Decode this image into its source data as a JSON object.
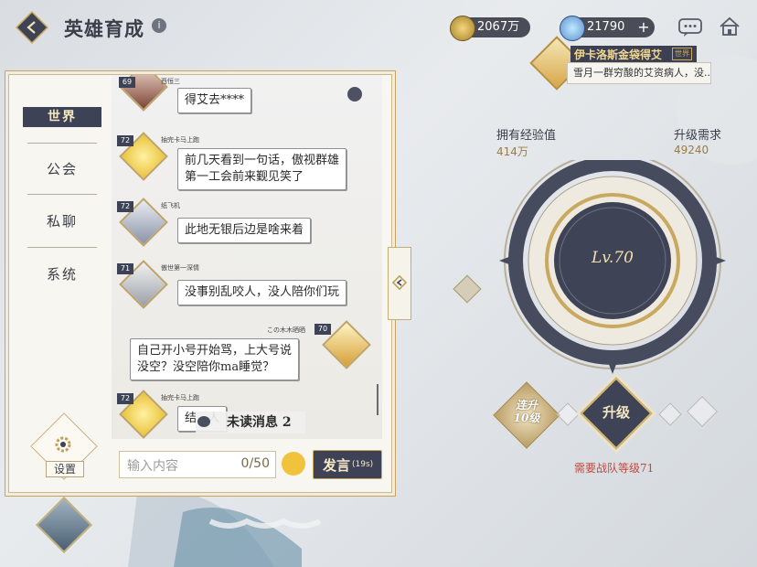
{
  "topbar": {
    "title": "英雄育成",
    "gold": "2067万",
    "gems": "21790",
    "plus": "+",
    "info": "i"
  },
  "hero": {
    "name": "伊卡洛斯金袋得艾",
    "tag": "世界",
    "desc": "雪月一群穷酸的艾资病人，没..."
  },
  "stats": {
    "exp_label": "拥有经验值",
    "exp_value": "414万",
    "need_label": "升级需求",
    "need_value": "49240",
    "level": "Lv.70"
  },
  "actions": {
    "burst_label_1": "连升",
    "burst_label_2": "10级",
    "upgrade": "升级",
    "requirement": "需要战队等级71"
  },
  "nav": {
    "world": "世界",
    "guild": "公会",
    "private": "私聊",
    "system": "系统",
    "settings": "设置"
  },
  "messages": [
    {
      "level": "69",
      "user": "西恒三",
      "text": "得艾去****"
    },
    {
      "level": "72",
      "user": "抽完卡马上跑",
      "text_1": "前几天看到一句话，傲视群雄",
      "text_2": "第一工会前来觐见笑了"
    },
    {
      "level": "72",
      "user": "纸飞机",
      "text": "此地无银后边是啥来着"
    },
    {
      "level": "71",
      "user": "傲世第一深情",
      "text": "没事别乱咬人，没人陪你们玩"
    },
    {
      "level": "70",
      "user": "この木木晒晒",
      "text_1": "自己开小号开始骂，上大号说",
      "text_2": "没空？没空陪你ma睡觉？"
    },
    {
      "level": "72",
      "user": "抽完卡马上跑",
      "text": "结...人"
    }
  ],
  "chat": {
    "unread": "未读消息 2",
    "placeholder": "输入内容",
    "count": "0/50",
    "send": "发言",
    "timer": "(19s)"
  },
  "colors": {
    "accent_dark": "#3d4257",
    "gold": "#c9a85c",
    "warning": "#c2493f"
  },
  "icons": [
    "back-icon",
    "info-icon",
    "gold-coin-icon",
    "gem-icon",
    "chat-icon",
    "home-icon",
    "gear-icon",
    "emoji-icon",
    "collapse-icon",
    "scroll-top-icon"
  ]
}
